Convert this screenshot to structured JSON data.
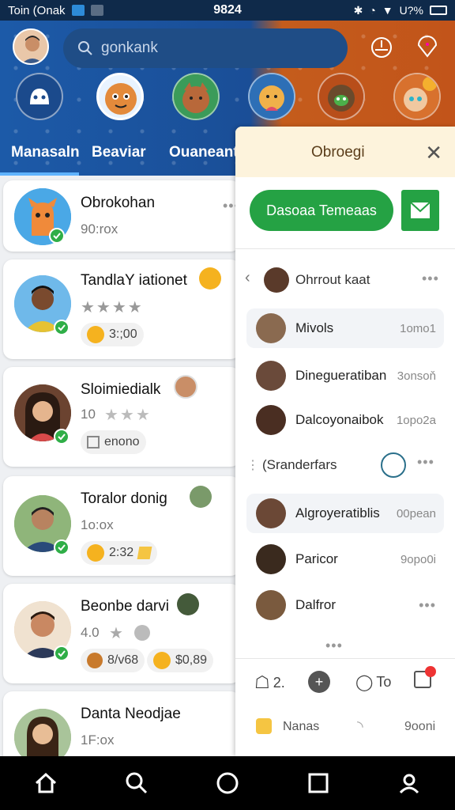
{
  "status": {
    "carrier": "Toin (Onak",
    "time": "9824",
    "battery": "U?%"
  },
  "header": {
    "search_placeholder": "gonkank",
    "tabs": [
      "Manasaln",
      "Beaviar",
      "Ouaneant"
    ]
  },
  "list": [
    {
      "name": "Obrokohan",
      "sub": "90:rox"
    },
    {
      "name": "TandlaY iationet",
      "stars": "★★★★",
      "chip": "3:;00"
    },
    {
      "name": "Sloimiedialk",
      "rating": "10",
      "stars": "★★★",
      "chip": "enono"
    },
    {
      "name": "Toralor donig",
      "sub": "1o:ox",
      "chip": "2:32"
    },
    {
      "name": "Beonbe darvi",
      "rating": "4.0",
      "stars": "★",
      "chip1": "8/v68",
      "chip2": "$0,89"
    },
    {
      "name": "Danta Neodjae",
      "sub": "1F:ox"
    }
  ],
  "panel": {
    "title": "Obroegi",
    "close": "✕",
    "primary_btn": "Dasoaa Temeaas",
    "group1_header": "Ohrrout kaat",
    "rows1": [
      {
        "name": "Mivols",
        "time": "1omo1"
      },
      {
        "name": "Dinegueratiban",
        "time": "3onsoň"
      },
      {
        "name": "Dalcoyonaibok",
        "time": "1opo2a"
      }
    ],
    "group2_header": "(Sranderfars",
    "rows2": [
      {
        "name": "Algroyeratiblis",
        "time": "00pean"
      },
      {
        "name": "Paricor",
        "time": "9opo0i"
      },
      {
        "name": "Dalfror",
        "time": ""
      }
    ],
    "tool1": "2.",
    "tool2": "To",
    "footer_label": "Nanas",
    "footer_time": "9ooni"
  },
  "colors": {
    "accent_green": "#25a244",
    "header_blue": "#1c5aa8",
    "header_orange": "#c45c1c"
  }
}
